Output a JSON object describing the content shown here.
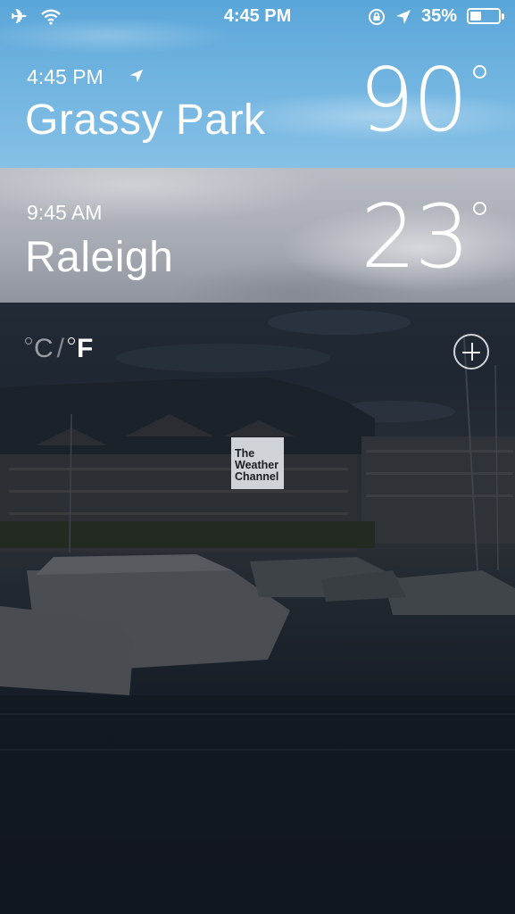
{
  "status_bar": {
    "time": "4:45 PM",
    "battery_percent": "35%",
    "battery_level": 0.35,
    "icons": [
      "airplane-icon",
      "wifi-icon",
      "rotation-lock-icon",
      "location-arrow-icon",
      "battery-icon"
    ]
  },
  "cities": [
    {
      "local_time": "4:45 PM",
      "name": "Grassy Park",
      "temperature": "90",
      "current_location": true
    },
    {
      "local_time": "9:45 AM",
      "name": "Raleigh",
      "temperature": "23",
      "current_location": false
    }
  ],
  "units": {
    "celsius": "C",
    "separator": "/",
    "fahrenheit": "F",
    "selected": "F"
  },
  "logo": {
    "line1": "The",
    "line2": "Weather",
    "line3": "Channel"
  },
  "colors": {
    "sky_blue": "#6fb3e0",
    "cloud_gray": "#a7abb4",
    "overlay_dark": "#1f2733"
  }
}
